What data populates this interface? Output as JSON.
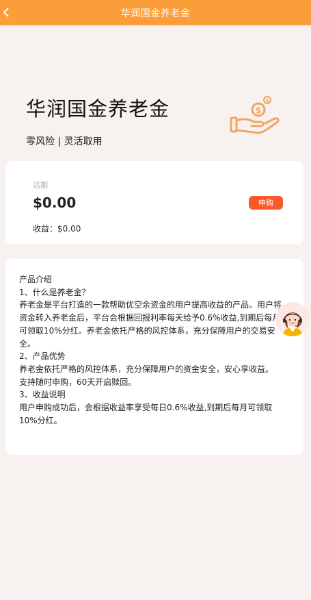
{
  "header": {
    "title": "华润国金养老金"
  },
  "hero": {
    "title": "华润国金养老金",
    "subtitle": "零风险 | 灵活取用"
  },
  "balance_card": {
    "label": "活期",
    "amount": "$0.00",
    "apply_label": "申购",
    "earnings_label": "收益：",
    "earnings_value": "$0.00"
  },
  "info_card": {
    "lines": [
      "产品介绍",
      "1、什么是养老金？",
      "养老金是平台打造的一款帮助优空余资金的用户提高收益的产品。用户将资金转入养老金后，平台会根据回报利率每天给予0.6%收益,到期后每月可领取10%分红。养老金依托严格的风控体系，充分保障用户的交易安全。",
      "2、产品优势",
      "养老金依托严格的风控体系，充分保障用户的资金安全，安心享收益。",
      "支持随时申购，60天开启赎回。",
      "3、收益说明",
      "用户申购成功后，会根据收益率享受每日0.6%收益,到期后每月可领取10%分红。"
    ]
  },
  "colors": {
    "accent": "#fb9d38",
    "button": "#fa5a2a",
    "background": "#f7f2f0"
  },
  "icons": {
    "back": "chevron-left-icon",
    "hero": "hand-coin-icon",
    "support": "customer-service-icon"
  }
}
